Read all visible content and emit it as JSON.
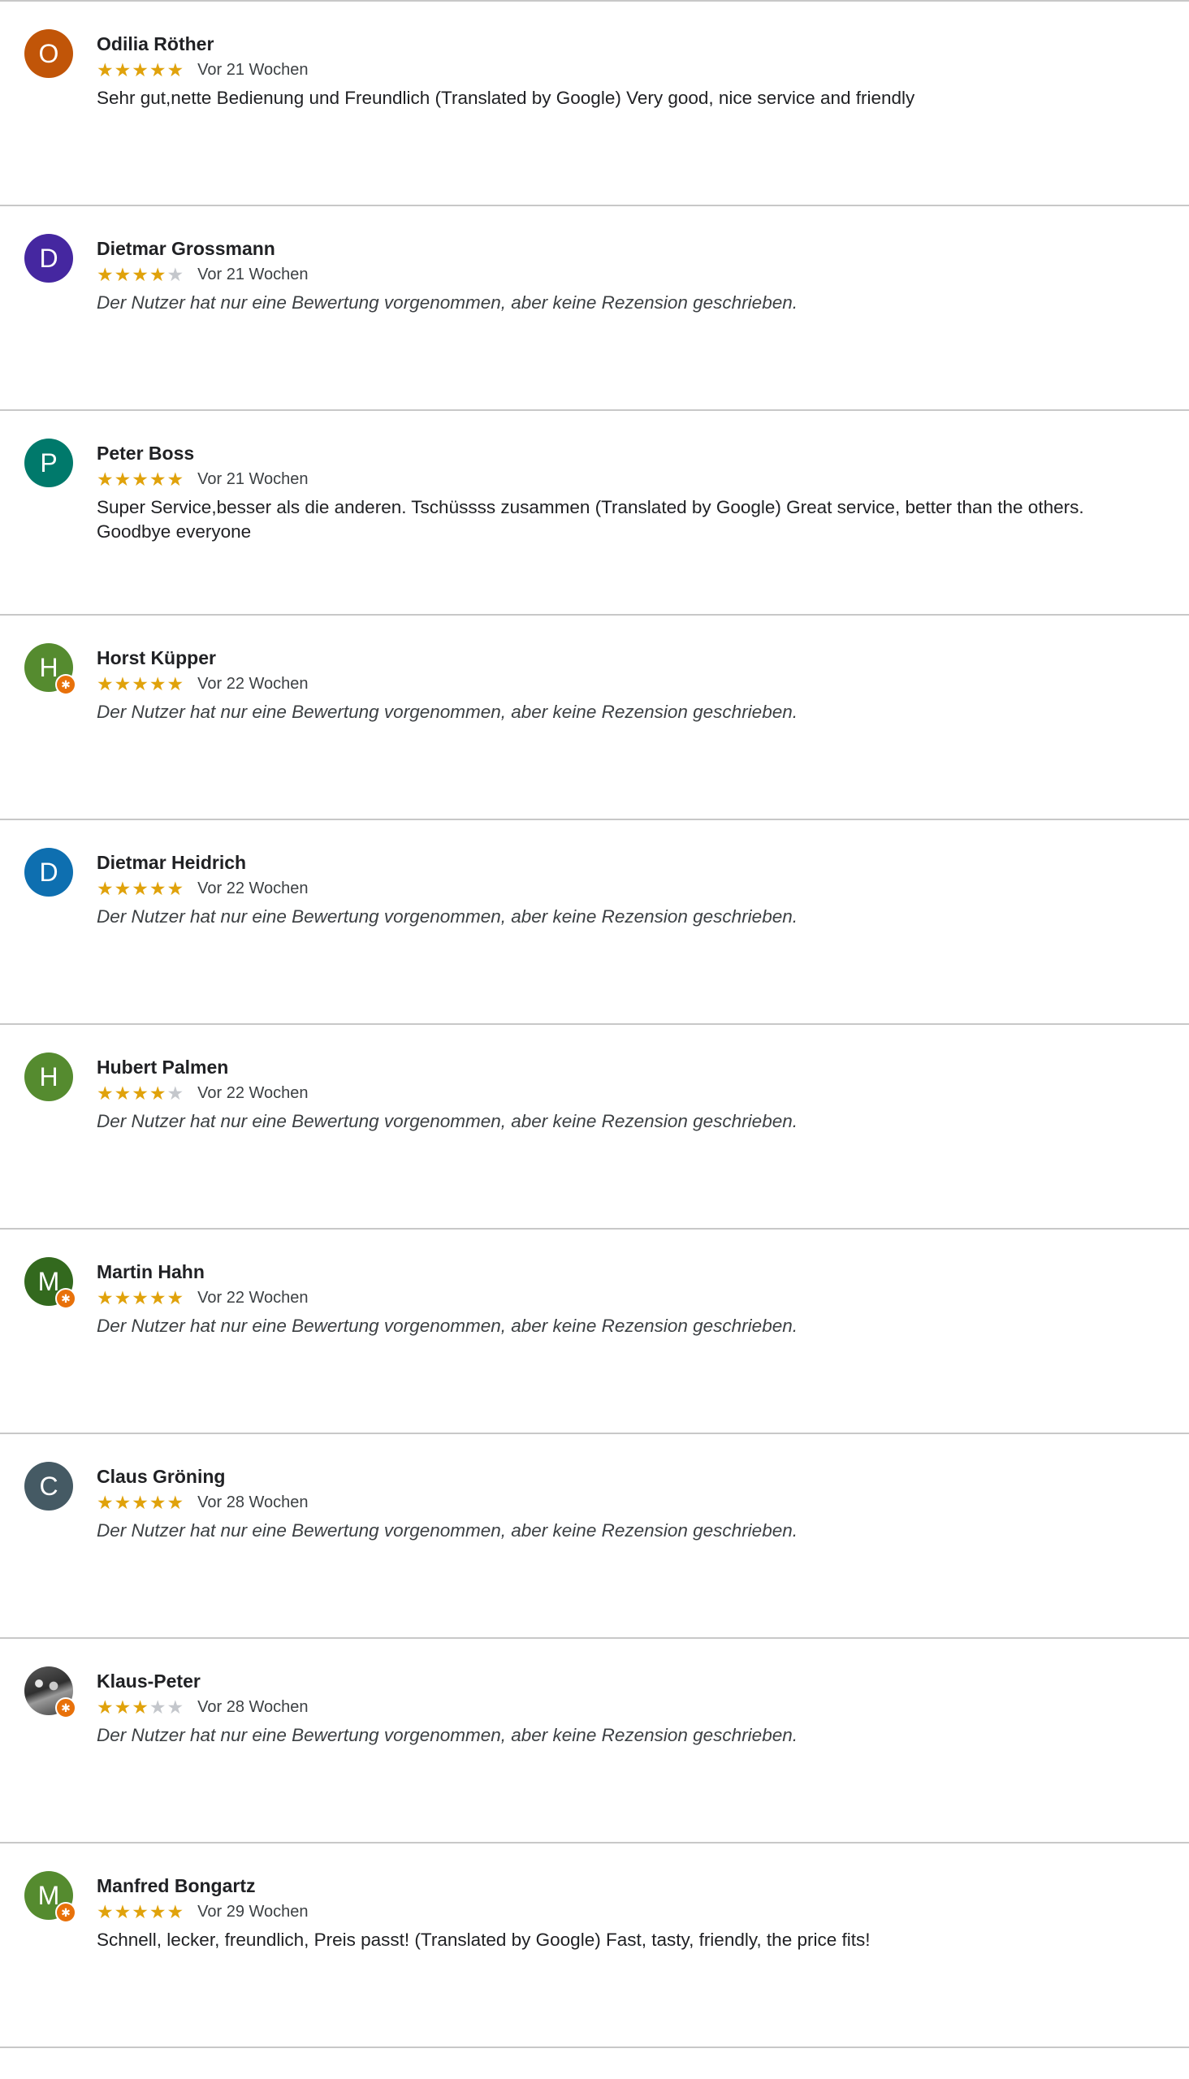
{
  "reviews": [
    {
      "name": "Odilia Röther",
      "initial": "O",
      "avatar_color": "#c15508",
      "local_guide": false,
      "photo": false,
      "rating": 5,
      "date": "Vor 21 Wochen",
      "text": "Sehr gut,nette Bedienung und Freundlich (Translated by Google) Very good, nice service and friendly",
      "no_review": false
    },
    {
      "name": "Dietmar Grossmann",
      "initial": "D",
      "avatar_color": "#4527a0",
      "local_guide": false,
      "photo": false,
      "rating": 4,
      "date": "Vor 21 Wochen",
      "text": "Der Nutzer hat nur eine Bewertung vorgenommen, aber keine Rezension geschrieben.",
      "no_review": true
    },
    {
      "name": "Peter Boss",
      "initial": "P",
      "avatar_color": "#00796b",
      "local_guide": false,
      "photo": false,
      "rating": 5,
      "date": "Vor 21 Wochen",
      "text": "Super Service,besser als die anderen. Tschüssss zusammen (Translated by Google) Great service, better than the others. Goodbye everyone",
      "no_review": false
    },
    {
      "name": "Horst Küpper",
      "initial": "H",
      "avatar_color": "#558b2f",
      "local_guide": true,
      "photo": false,
      "rating": 5,
      "date": "Vor 22 Wochen",
      "text": "Der Nutzer hat nur eine Bewertung vorgenommen, aber keine Rezension geschrieben.",
      "no_review": true
    },
    {
      "name": "Dietmar Heidrich",
      "initial": "D",
      "avatar_color": "#0e6fb0",
      "local_guide": false,
      "photo": false,
      "rating": 5,
      "date": "Vor 22 Wochen",
      "text": "Der Nutzer hat nur eine Bewertung vorgenommen, aber keine Rezension geschrieben.",
      "no_review": true
    },
    {
      "name": "Hubert Palmen",
      "initial": "H",
      "avatar_color": "#558b2f",
      "local_guide": false,
      "photo": false,
      "rating": 4,
      "date": "Vor 22 Wochen",
      "text": "Der Nutzer hat nur eine Bewertung vorgenommen, aber keine Rezension geschrieben.",
      "no_review": true
    },
    {
      "name": "Martin Hahn",
      "initial": "M",
      "avatar_color": "#33691e",
      "local_guide": true,
      "photo": false,
      "rating": 5,
      "date": "Vor 22 Wochen",
      "text": "Der Nutzer hat nur eine Bewertung vorgenommen, aber keine Rezension geschrieben.",
      "no_review": true
    },
    {
      "name": "Claus Gröning",
      "initial": "C",
      "avatar_color": "#455a64",
      "local_guide": false,
      "photo": false,
      "rating": 5,
      "date": "Vor 28 Wochen",
      "text": "Der Nutzer hat nur eine Bewertung vorgenommen, aber keine Rezension geschrieben.",
      "no_review": true
    },
    {
      "name": "Klaus-Peter",
      "initial": "",
      "avatar_color": "#4a4a4a",
      "local_guide": true,
      "photo": true,
      "rating": 3,
      "date": "Vor 28 Wochen",
      "text": "Der Nutzer hat nur eine Bewertung vorgenommen, aber keine Rezension geschrieben.",
      "no_review": true
    },
    {
      "name": "Manfred Bongartz",
      "initial": "M",
      "avatar_color": "#558b2f",
      "local_guide": true,
      "photo": false,
      "rating": 5,
      "date": "Vor 29 Wochen",
      "text": "Schnell, lecker, freundlich, Preis passt! (Translated by Google) Fast, tasty, friendly, the price fits!",
      "no_review": false
    }
  ],
  "icons": {
    "star": "★",
    "local_guide_badge": "✱"
  },
  "colors": {
    "star_filled": "#e0a20b",
    "star_empty": "#c4c7cc",
    "divider": "#c8c8c8",
    "local_guide_badge": "#e8710a"
  }
}
